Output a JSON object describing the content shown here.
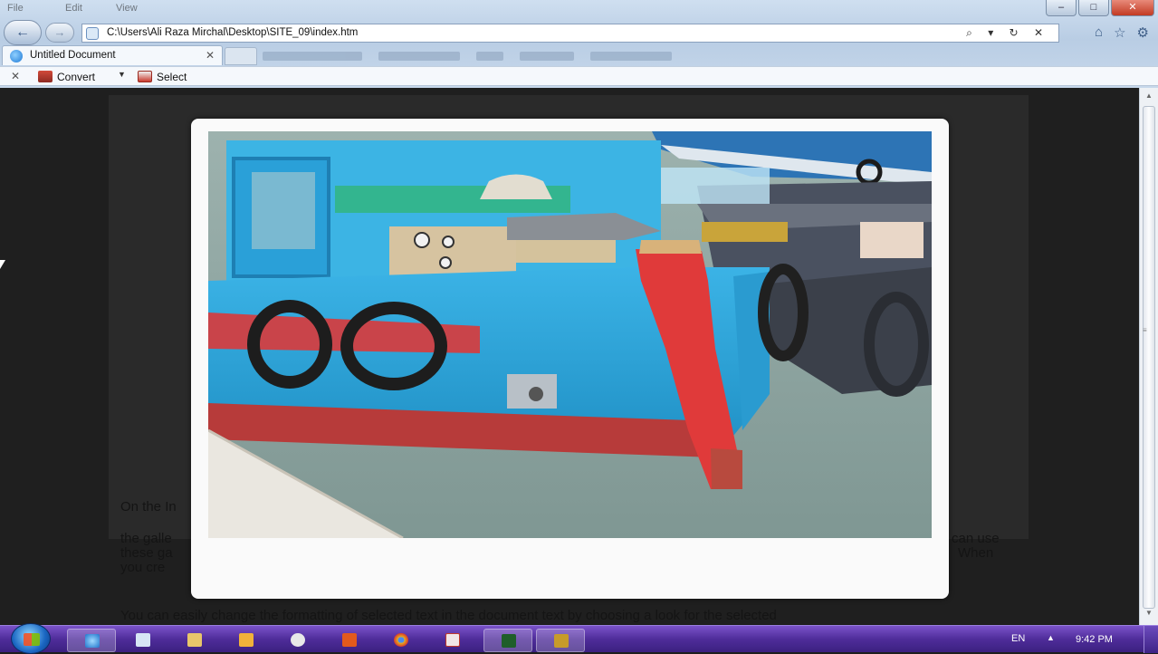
{
  "window": {
    "menu": [
      "File",
      "Edit",
      "View"
    ],
    "controls": {
      "minimize": "–",
      "maximize": "□",
      "close": "✕"
    }
  },
  "nav": {
    "back_icon": "arrow-left-icon",
    "forward_icon": "arrow-right-icon",
    "address": "C:\\Users\\Ali Raza Mirchal\\Desktop\\SITE_09\\index.htm",
    "address_tools": "⌕ ▾ ↻ ✕"
  },
  "toolbar_icons": [
    "home-icon",
    "star-icon",
    "gear-icon"
  ],
  "tab": {
    "title": "Untitled Document",
    "close": "✕"
  },
  "command_bar": {
    "close": "✕",
    "convert_label": "Convert",
    "dropdown": "▼",
    "select_label": "Select"
  },
  "page": {
    "para1": "On the In",
    "para2a": "the galle",
    "para2b": "can use",
    "para2c": "these ga",
    "para2d": "When",
    "para2e": "you cre",
    "para3": "You can easily change the formatting of selected text in the document text by choosing a look for the selected"
  },
  "lightbox": {
    "image": "photo of a blue and red wooden fishing boat moored at a stone quay"
  },
  "taskbar": {
    "language": "EN",
    "tray_arrow": "▲",
    "time": "9:42 PM"
  },
  "colors": {
    "boat_blue": "#2ea4d6",
    "boat_red": "#d63b3b",
    "water": "#8fa6a3",
    "taskbar": "#4f2d9a"
  }
}
